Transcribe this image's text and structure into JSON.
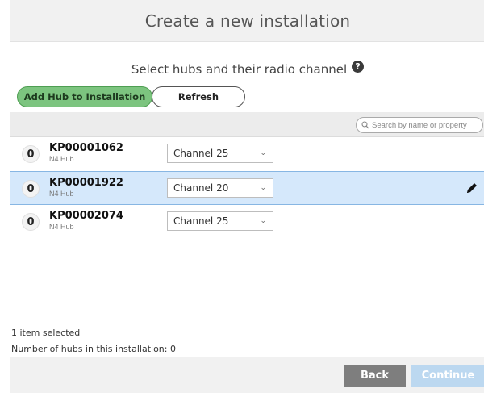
{
  "dialog": {
    "title": "Create a new installation",
    "subtitle": "Select hubs and their radio channel",
    "help_icon_glyph": "?"
  },
  "actions": {
    "add_hub_label": "Add Hub to Installation",
    "refresh_label": "Refresh"
  },
  "search": {
    "placeholder": "Search by name or property"
  },
  "hubs": [
    {
      "count": "0",
      "id": "KP00001062",
      "type": "N4 Hub",
      "channel": "Channel 25",
      "selected": false
    },
    {
      "count": "0",
      "id": "KP00001922",
      "type": "N4 Hub",
      "channel": "Channel 20",
      "selected": true
    },
    {
      "count": "0",
      "id": "KP00002074",
      "type": "N4 Hub",
      "channel": "Channel 25",
      "selected": false
    }
  ],
  "status": {
    "selection": "1 item selected",
    "hub_count": "Number of hubs in this installation:  0"
  },
  "footer": {
    "back_label": "Back",
    "continue_label": "Continue"
  },
  "colors": {
    "accent_green": "#7cc47f",
    "selected_row": "#d5e8fb",
    "back_button": "#7e7e7e",
    "continue_disabled": "#bcd8f0"
  },
  "icons": {
    "help": "question-circle-icon",
    "search": "magnifier-icon",
    "edit": "pencil-icon",
    "dropdown": "chevron-down-icon"
  }
}
